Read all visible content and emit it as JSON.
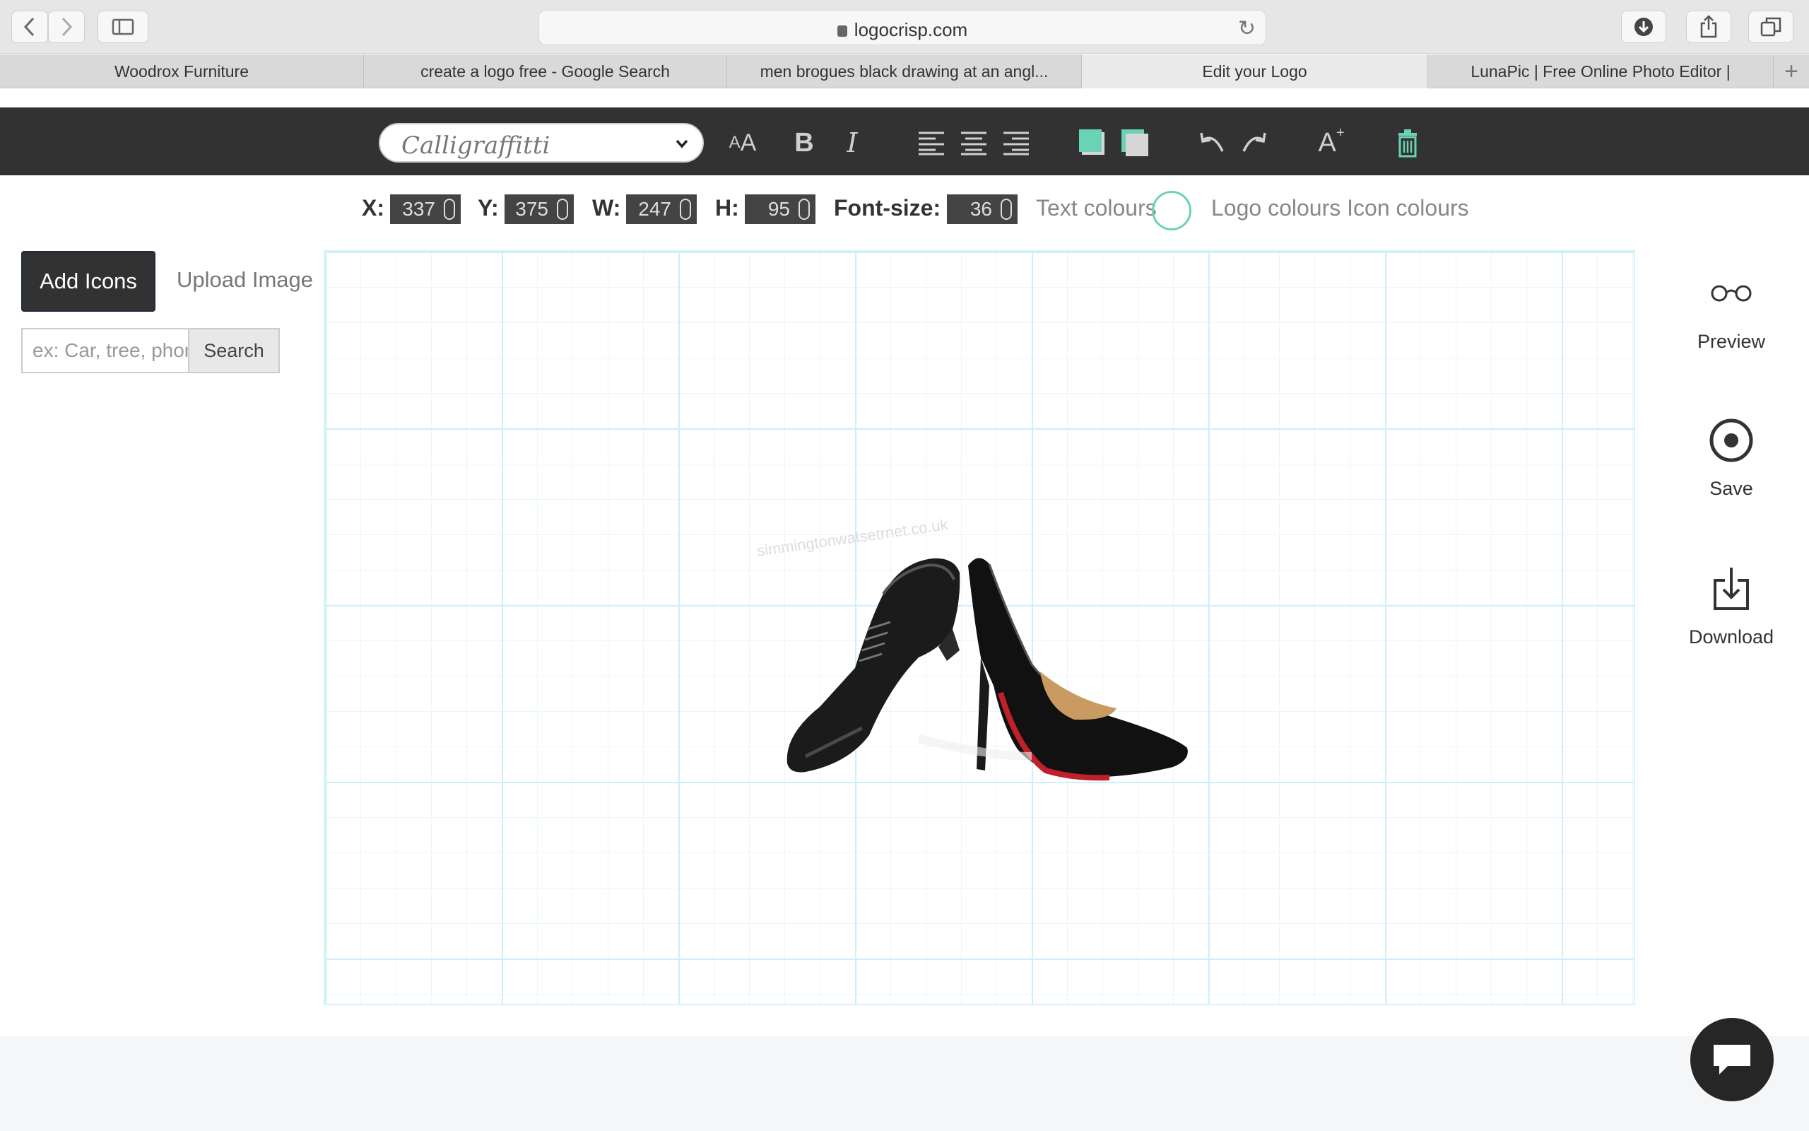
{
  "browser": {
    "url": "logocrisp.com",
    "tabs": [
      {
        "label": "Woodrox Furniture",
        "active": false
      },
      {
        "label": "create a logo free - Google Search",
        "active": false
      },
      {
        "label": "men brogues black drawing at an angl...",
        "active": false
      },
      {
        "label": "Edit your Logo",
        "active": true
      },
      {
        "label": "LunaPic | Free Online Photo Editor |",
        "active": false
      }
    ]
  },
  "editor": {
    "font_name": "Calligraffitti",
    "coords": {
      "x_label": "X:",
      "x": "337",
      "y_label": "Y:",
      "y": "375",
      "w_label": "W:",
      "w": "247",
      "h_label": "H:",
      "h": "95",
      "fs_label": "Font-size:",
      "fs": "36"
    },
    "text_colours_label": "Text colours",
    "logo_colours_label": "Logo colours Icon colours",
    "accent_color": "#6bd3b5"
  },
  "left_panel": {
    "add_icons": "Add Icons",
    "upload_image": "Upload Image",
    "search_placeholder": "ex: Car, tree, phone",
    "search_button": "Search"
  },
  "canvas": {
    "watermark": "simmingtonwatsetrnet.co.uk"
  },
  "actions": {
    "preview": "Preview",
    "save": "Save",
    "download": "Download"
  }
}
